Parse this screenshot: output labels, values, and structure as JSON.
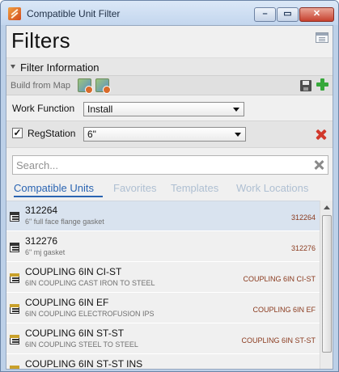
{
  "window": {
    "title": "Compatible Unit Filter"
  },
  "header": {
    "title": "Filters"
  },
  "filter_section": {
    "title": "Filter Information",
    "build_from_map_label": "Build from Map",
    "work_function": {
      "label": "Work Function",
      "value": "Install"
    },
    "reg_station": {
      "label": "RegStation",
      "checked": true,
      "check_glyph": "✓",
      "value": "6\""
    }
  },
  "search": {
    "placeholder": "Search..."
  },
  "tabs": [
    {
      "label": "Compatible Units",
      "active": true
    },
    {
      "label": "Favorites",
      "active": false
    },
    {
      "label": "Templates",
      "active": false
    },
    {
      "label": "Work Locations",
      "active": false
    }
  ],
  "units": [
    {
      "title": "312264",
      "subtitle": "6\" full face flange gasket",
      "code": "312264",
      "icon": "unit-icon"
    },
    {
      "title": "312276",
      "subtitle": "6\" mj gasket",
      "code": "312276",
      "icon": "unit-icon"
    },
    {
      "title": "COUPLING 6IN CI-ST",
      "subtitle": "6IN COUPLING CAST IRON TO STEEL",
      "code": "COUPLING 6IN CI-ST",
      "icon": "unit-icon-colored"
    },
    {
      "title": "COUPLING 6IN EF",
      "subtitle": "6IN COUPLING ELECTROFUSION IPS",
      "code": "COUPLING 6IN EF",
      "icon": "unit-icon-colored"
    },
    {
      "title": "COUPLING 6IN ST-ST",
      "subtitle": "6IN COUPLING STEEL TO STEEL",
      "code": "COUPLING 6IN ST-ST",
      "icon": "unit-icon-colored"
    },
    {
      "title": "COUPLING 6IN ST-ST INS",
      "subtitle": "",
      "code": "",
      "icon": "unit-icon-colored"
    }
  ],
  "colors": {
    "accent": "#2a64b2",
    "tab_inactive": "#aebfd2",
    "code_text": "#8a3a1e",
    "delete": "#d1382b",
    "add": "#36a83a"
  }
}
